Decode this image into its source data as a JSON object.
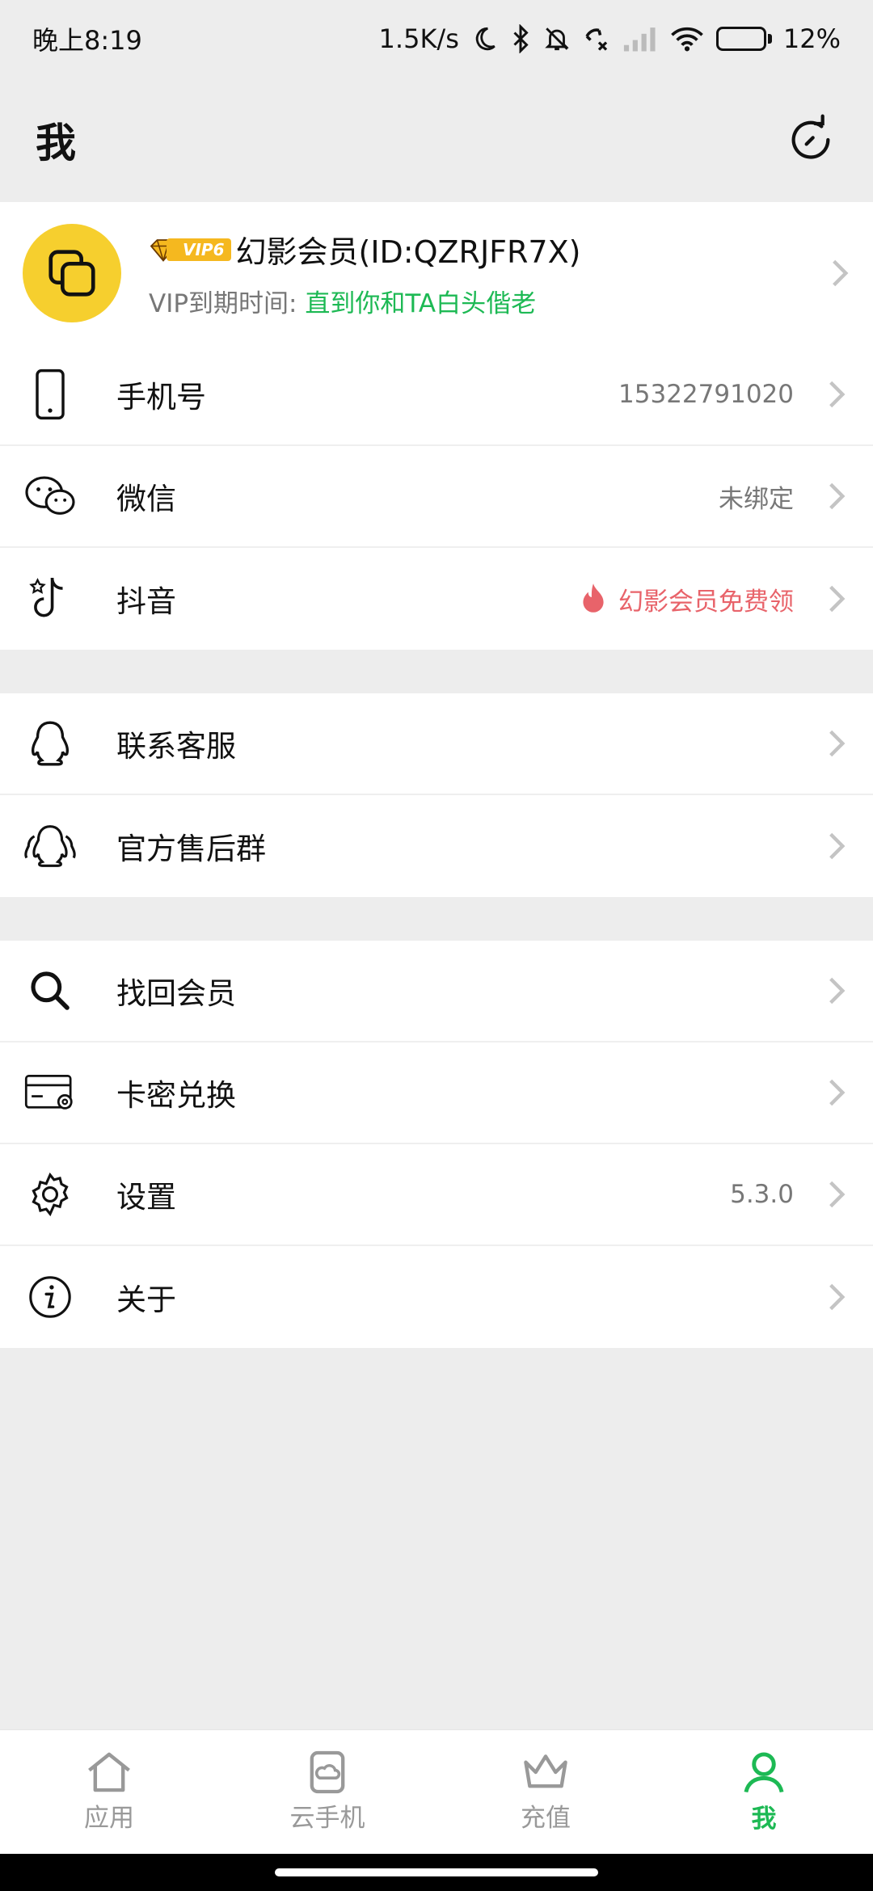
{
  "status_bar": {
    "time": "晚上8:19",
    "net_speed": "1.5K/s",
    "battery": "12%",
    "battery_level": 0.12,
    "icons": [
      "moon-icon",
      "bluetooth-icon",
      "mute-bell-icon",
      "call-blocked-icon",
      "signal-icon",
      "wifi-icon",
      "battery-icon"
    ]
  },
  "header": {
    "title": "我"
  },
  "profile": {
    "vip_badge": "VIP6",
    "name": "幻影会员(ID:QZRJFR7X)",
    "expiry_label": "VIP到期时间:",
    "expiry_value": "直到你和TA白头偕老"
  },
  "group1": [
    {
      "icon": "phone-icon",
      "label": "手机号",
      "value": "15322791020"
    },
    {
      "icon": "wechat-icon",
      "label": "微信",
      "value": "未绑定"
    },
    {
      "icon": "tiktok-icon",
      "label": "抖音",
      "value": "幻影会员免费领"
    }
  ],
  "group2": [
    {
      "icon": "qq-icon",
      "label": "联系客服"
    },
    {
      "icon": "qq-group-icon",
      "label": "官方售后群"
    }
  ],
  "group3": [
    {
      "icon": "search-icon",
      "label": "找回会员"
    },
    {
      "icon": "card-icon",
      "label": "卡密兑换"
    },
    {
      "icon": "gear-icon",
      "label": "设置",
      "value": "5.3.0"
    },
    {
      "icon": "info-icon",
      "label": "关于"
    }
  ],
  "nav": [
    {
      "icon": "home-icon",
      "label": "应用"
    },
    {
      "icon": "cloud-phone-icon",
      "label": "云手机"
    },
    {
      "icon": "crown-icon",
      "label": "充值"
    },
    {
      "icon": "person-icon",
      "label": "我"
    }
  ],
  "colors": {
    "accent": "#1db954",
    "avatar": "#f6cf2e",
    "promo": "#e8636a",
    "background": "#ededed"
  }
}
